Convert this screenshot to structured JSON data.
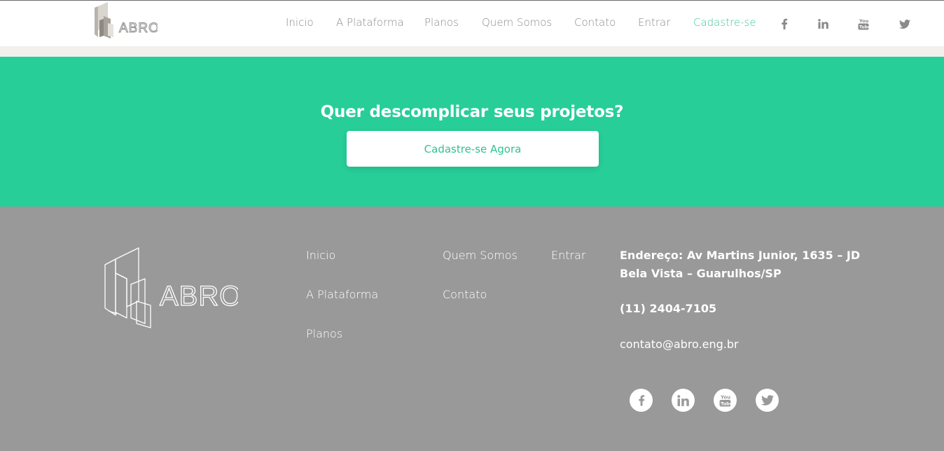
{
  "header": {
    "logo_alt": "ABRO",
    "nav": [
      {
        "label": "Inicio"
      },
      {
        "label": "A Plataforma"
      },
      {
        "label": "Planos"
      },
      {
        "label": "Quem Somos"
      },
      {
        "label": "Contato"
      },
      {
        "label": "Entrar"
      },
      {
        "label": "Cadastre-se"
      }
    ],
    "social_icons": [
      "facebook-icon",
      "linkedin-icon",
      "youtube-icon",
      "twitter-icon"
    ]
  },
  "cta": {
    "title": "Quer descomplicar seus projetos?",
    "button_label": "Cadastre-se Agora"
  },
  "footer": {
    "logo_alt": "ABRO",
    "links_col1": [
      "Inicio",
      "A Plataforma",
      "Planos"
    ],
    "links_col2": [
      "Quem Somos",
      "Contato"
    ],
    "links_col3": [
      "Entrar"
    ],
    "address_line1": "Endereço: Av Martins Junior, 1635 – JD",
    "address_line2": "Bela Vista – Guarulhos/SP",
    "phone": "(11) 2404-7105",
    "email": "contato@abro.eng.br",
    "social_icons": [
      "facebook-icon",
      "linkedin-icon",
      "youtube-icon",
      "twitter-icon"
    ]
  },
  "colors": {
    "brand_green": "#27ce98",
    "active_link": "#3ec894",
    "footer_bg": "#999999",
    "nav_text": "#8a8a8a"
  }
}
